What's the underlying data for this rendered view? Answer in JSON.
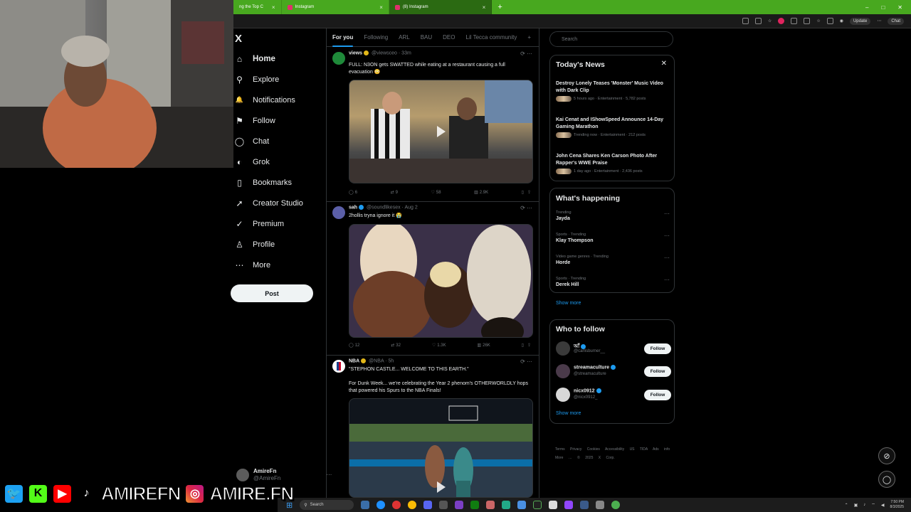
{
  "browser": {
    "tabs": [
      {
        "label": "ng the Top C"
      },
      {
        "label": "Instagram"
      },
      {
        "label": "(8) Instagram"
      }
    ],
    "new_tab": "+",
    "update_label": "Update",
    "chat_label": "Chat",
    "window_controls": [
      "–",
      "□",
      "✕"
    ]
  },
  "x": {
    "logo": "X",
    "nav": [
      {
        "label": "Home",
        "icon": "home-icon",
        "glyph": "⌂"
      },
      {
        "label": "Explore",
        "icon": "search-icon",
        "glyph": "⚲"
      },
      {
        "label": "Notifications",
        "icon": "bell-icon",
        "glyph": "🔔"
      },
      {
        "label": "Follow",
        "icon": "follow-icon",
        "glyph": "⚑"
      },
      {
        "label": "Chat",
        "icon": "chat-icon",
        "glyph": "◯"
      },
      {
        "label": "Grok",
        "icon": "grok-icon",
        "glyph": "◐"
      },
      {
        "label": "Bookmarks",
        "icon": "bookmark-icon",
        "glyph": "▯"
      },
      {
        "label": "Creator Studio",
        "icon": "rocket-icon",
        "glyph": "➚"
      },
      {
        "label": "Premium",
        "icon": "premium-icon",
        "glyph": "✓"
      },
      {
        "label": "Profile",
        "icon": "profile-icon",
        "glyph": "♙"
      },
      {
        "label": "More",
        "icon": "more-icon",
        "glyph": "⋯"
      }
    ],
    "post_label": "Post",
    "user": {
      "name": "AmireFn",
      "handle": "@AmireFn"
    },
    "feed_tabs": [
      "For you",
      "Following",
      "ARL",
      "BAU",
      "DEO",
      "Lil Tecca community",
      "+"
    ],
    "tweets": [
      {
        "name": "views",
        "handle": "@viewsceo",
        "time": "33m",
        "text": "FULL: N3ON gets SWATTED while eating at a restaurant causing a full evacuation 😳",
        "stats": {
          "replies": "6",
          "reposts": "9",
          "likes": "58",
          "views": "2.9K"
        }
      },
      {
        "name": "sah",
        "handle": "@soundlikesex",
        "time": "Aug 2",
        "text": "2hollis tryna ignore it 😭",
        "stats": {
          "replies": "12",
          "reposts": "32",
          "likes": "1.3K",
          "views": "26K"
        }
      },
      {
        "name": "NBA",
        "handle": "@NBA",
        "time": "5h",
        "text": "\"STEPHON CASTLE... WELCOME TO THIS EARTH.\"",
        "text2": "For Dunk Week... we're celebrating the Year 2 phenom's OTHERWORLDLY hops that powered his Spurs to the NBA Finals!"
      }
    ],
    "search_placeholder": "Search",
    "todays_news": {
      "title": "Today's News",
      "items": [
        {
          "title": "Destroy Lonely Teases 'Monster' Music Video with Dark Clip",
          "meta": "5 hours ago · Entertainment · 5,782 posts"
        },
        {
          "title": "Kai Cenat and IShowSpeed Announce 14-Day Gaming Marathon",
          "meta": "Trending now · Entertainment · 212 posts"
        },
        {
          "title": "John Cena Shares Ken Carson Photo After Rapper's WWE Praise",
          "meta": "1 day ago · Entertainment · 2,436 posts"
        }
      ]
    },
    "happening": {
      "title": "What's happening",
      "items": [
        {
          "context": "Trending",
          "name": "Jayda"
        },
        {
          "context": "Sports · Trending",
          "name": "Klay Thompson"
        },
        {
          "context": "Video game genres · Trending",
          "name": "Horde"
        },
        {
          "context": "Sports · Trending",
          "name": "Derek Hill"
        }
      ],
      "show_more": "Show more"
    },
    "who_to_follow": {
      "title": "Who to follow",
      "items": [
        {
          "name": "আঁ",
          "handle": "@carlisburner__"
        },
        {
          "name": "streamaculture",
          "handle": "@streamaculture"
        },
        {
          "name": "nicx0912",
          "handle": "@nicx0912_"
        }
      ],
      "follow_label": "Follow",
      "show_more": "Show more"
    },
    "footer": "Terms Privacy Cookies Accessibility US TIDA Ads info More … © 2025 X Corp."
  },
  "overlay": {
    "name": "AMIREFN",
    "ig": "AMIRE.FN"
  },
  "taskbar": {
    "search": "Search",
    "time": "7:50 PM",
    "date": "8/3/2025"
  },
  "colors": {
    "accent": "#1d9bf0",
    "chrome_green": "#48a81f",
    "border": "#2f3336"
  }
}
